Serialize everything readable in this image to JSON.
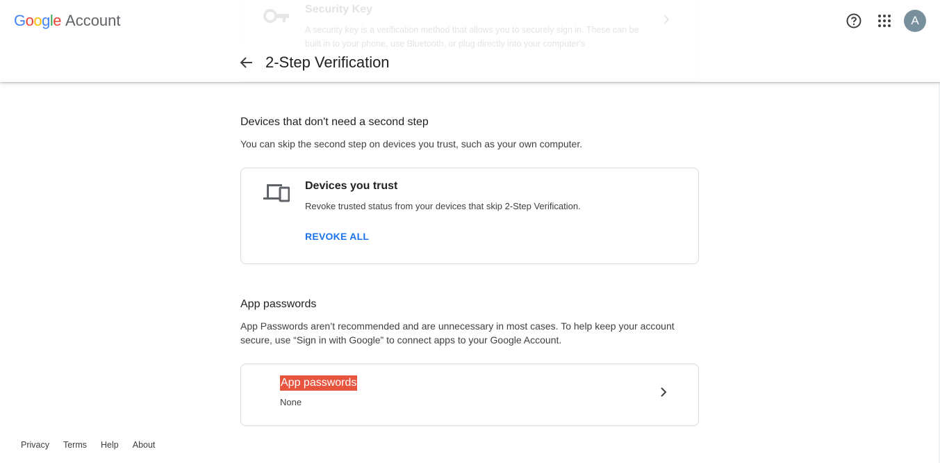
{
  "brand": {
    "google_letters": [
      {
        "ch": "G",
        "color": "#4285F4"
      },
      {
        "ch": "o",
        "color": "#EA4335"
      },
      {
        "ch": "o",
        "color": "#FBBC05"
      },
      {
        "ch": "g",
        "color": "#4285F4"
      },
      {
        "ch": "l",
        "color": "#34A853"
      },
      {
        "ch": "e",
        "color": "#EA4335"
      }
    ],
    "account_label": "Account"
  },
  "header": {
    "page_title": "2-Step Verification",
    "back_icon": "arrow-back-icon",
    "help_icon": "help-icon",
    "apps_icon": "apps-grid-icon",
    "avatar_initial": "A",
    "avatar_color": "#78909c"
  },
  "scrolled_card": {
    "title": "Security Key",
    "description": "A security key is a verification method that allows you to securely sign in. These can be built in to your phone, use Bluetooth, or plug directly into your computer's"
  },
  "devices_section": {
    "heading": "Devices that don't need a second step",
    "description": "You can skip the second step on devices you trust, such as your own computer.",
    "card": {
      "title": "Devices you trust",
      "description": "Revoke trusted status from your devices that skip 2-Step Verification.",
      "action_label": "REVOKE ALL"
    }
  },
  "app_passwords_section": {
    "heading": "App passwords",
    "description": "App Passwords aren’t recommended and are unnecessary in most cases. To help keep your account secure, use “Sign in with Google” to connect apps to your Google Account.",
    "card": {
      "title": "App passwords",
      "value": "None"
    }
  },
  "footer": {
    "links": [
      "Privacy",
      "Terms",
      "Help",
      "About"
    ]
  },
  "colors": {
    "accent": "#1a73e8",
    "highlight": "#e8553f"
  }
}
